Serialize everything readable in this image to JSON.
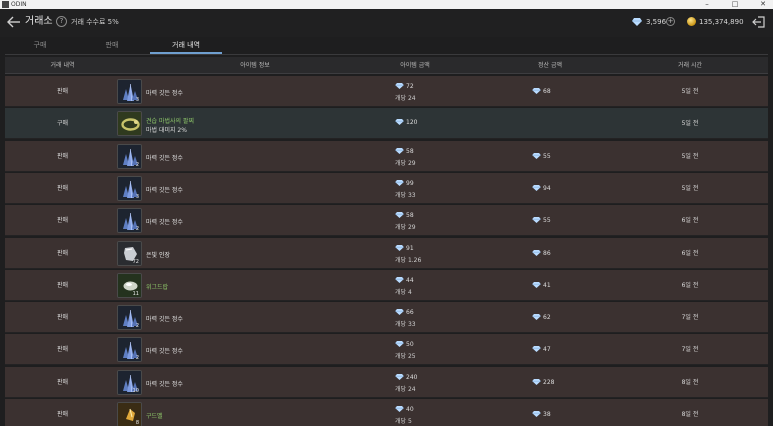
{
  "window": {
    "title": "ODIN"
  },
  "header": {
    "title": "거래소",
    "help": "?",
    "fee_text": "거래 수수료 5%",
    "diamonds": "3,596",
    "plus": "+",
    "gold": "135,374,890"
  },
  "tabs": [
    {
      "label": "구매",
      "active": false
    },
    {
      "label": "판매",
      "active": false
    },
    {
      "label": "거래 내역",
      "active": true
    }
  ],
  "columns": [
    "거래 내역",
    "아이템 정보",
    "아이템 금액",
    "정산 금액",
    "거래 시간"
  ],
  "rows": [
    {
      "type": "판매",
      "icon": "crystal",
      "qty": "3",
      "name": "마력 깃든 정수",
      "name_color": "white",
      "sub": "",
      "price": "72",
      "unit": "개당 24",
      "settle": "68",
      "time": "5일 전"
    },
    {
      "type": "구매",
      "icon": "bracelet",
      "qty": "",
      "name": "견습 마법사의 팔찌",
      "name_color": "green",
      "sub": "마법 대미지 2%",
      "price": "120",
      "unit": "",
      "settle": "",
      "time": "5일 전"
    },
    {
      "type": "판매",
      "icon": "crystal",
      "qty": "2",
      "name": "마력 깃든 정수",
      "name_color": "white",
      "sub": "",
      "price": "58",
      "unit": "개당 29",
      "settle": "55",
      "time": "5일 전"
    },
    {
      "type": "판매",
      "icon": "crystal",
      "qty": "3",
      "name": "마력 깃든 정수",
      "name_color": "white",
      "sub": "",
      "price": "99",
      "unit": "개당 33",
      "settle": "94",
      "time": "5일 전"
    },
    {
      "type": "판매",
      "icon": "crystal",
      "qty": "2",
      "name": "마력 깃든 정수",
      "name_color": "white",
      "sub": "",
      "price": "58",
      "unit": "개당 29",
      "settle": "55",
      "time": "6일 전"
    },
    {
      "type": "판매",
      "icon": "silver",
      "qty": "72",
      "name": "은빛 인장",
      "name_color": "white",
      "sub": "",
      "price": "91",
      "unit": "개당 1.26",
      "settle": "86",
      "time": "6일 전"
    },
    {
      "type": "판매",
      "icon": "ore",
      "qty": "11",
      "name": "위그드랍",
      "name_color": "green",
      "sub": "",
      "price": "44",
      "unit": "개당 4",
      "settle": "41",
      "time": "6일 전"
    },
    {
      "type": "판매",
      "icon": "crystal",
      "qty": "2",
      "name": "마력 깃든 정수",
      "name_color": "white",
      "sub": "",
      "price": "66",
      "unit": "개당 33",
      "settle": "62",
      "time": "7일 전"
    },
    {
      "type": "판매",
      "icon": "crystal",
      "qty": "2",
      "name": "마력 깃든 정수",
      "name_color": "white",
      "sub": "",
      "price": "50",
      "unit": "개당 25",
      "settle": "47",
      "time": "7일 전"
    },
    {
      "type": "판매",
      "icon": "crystal",
      "qty": "10",
      "name": "마력 깃든 정수",
      "name_color": "white",
      "sub": "",
      "price": "240",
      "unit": "개당 24",
      "settle": "228",
      "time": "8일 전"
    },
    {
      "type": "판매",
      "icon": "gold-ore",
      "qty": "8",
      "name": "구드벨",
      "name_color": "green",
      "sub": "",
      "price": "40",
      "unit": "개당 5",
      "settle": "38",
      "time": "8일 전"
    }
  ]
}
